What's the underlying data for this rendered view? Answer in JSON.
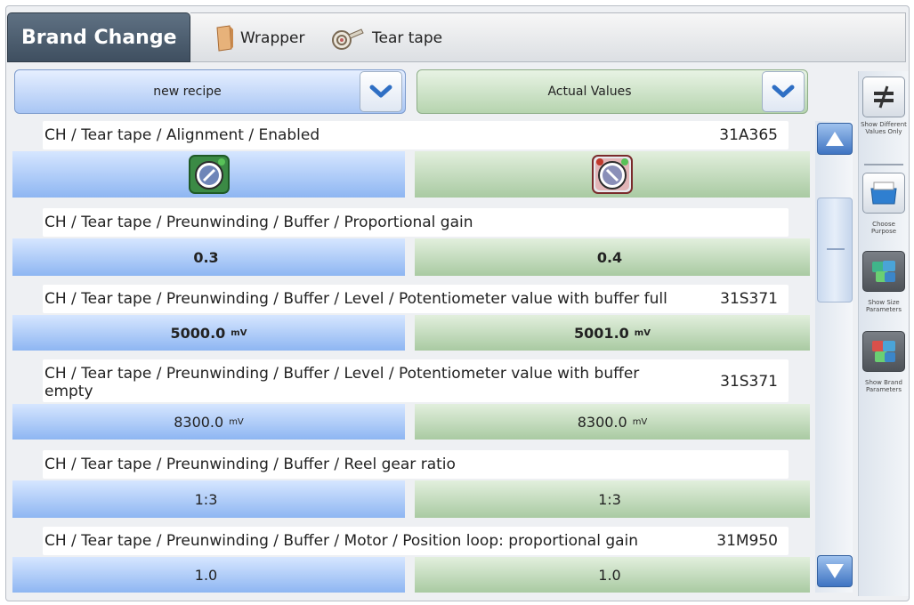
{
  "header": {
    "title": "Brand Change",
    "tabs": [
      {
        "label": "Wrapper",
        "icon": "wrapper-icon"
      },
      {
        "label": "Tear tape",
        "icon": "tear-tape-icon"
      }
    ]
  },
  "columns": {
    "left": {
      "label": "new recipe"
    },
    "right": {
      "label": "Actual Values"
    }
  },
  "rows": [
    {
      "title": "CH / Tear tape / Alignment / Enabled",
      "code": "31A365",
      "left": {
        "icon": "toggle-enabled-icon",
        "color": "#2f7d3a"
      },
      "right": {
        "icon": "toggle-disabled-icon",
        "color": "#c0392b"
      }
    },
    {
      "title": "CH / Tear tape / Preunwinding / Buffer / Proportional gain",
      "code": "",
      "left": {
        "value": "0.3",
        "unit": ""
      },
      "right": {
        "value": "0.4",
        "unit": ""
      }
    },
    {
      "title": "CH / Tear tape / Preunwinding / Buffer / Level / Potentiometer value with buffer full",
      "code": "31S371",
      "left": {
        "value": "5000.0",
        "unit": "mV"
      },
      "right": {
        "value": "5001.0",
        "unit": "mV"
      }
    },
    {
      "title": "CH / Tear tape / Preunwinding / Buffer / Level / Potentiometer value with buffer empty",
      "code": "31S371",
      "left": {
        "value": "8300.0",
        "unit": "mV"
      },
      "right": {
        "value": "8300.0",
        "unit": "mV"
      }
    },
    {
      "title": "CH / Tear tape / Preunwinding / Buffer / Reel gear ratio",
      "code": "",
      "left": {
        "value": "1:3",
        "unit": ""
      },
      "right": {
        "value": "1:3",
        "unit": ""
      }
    },
    {
      "title": "CH / Tear tape / Preunwinding / Buffer / Motor / Position loop: proportional gain",
      "code": "31M950",
      "left": {
        "value": "1.0",
        "unit": ""
      },
      "right": {
        "value": "1.0",
        "unit": ""
      }
    }
  ],
  "sidebar": {
    "buttons": [
      {
        "label": "Show Different Values Only",
        "icon": "not-equal-icon"
      },
      {
        "label": "Choose Purpose",
        "icon": "purpose-box-icon"
      },
      {
        "label": "Show Size Parameters",
        "icon": "size-parameters-icon"
      },
      {
        "label": "Show Brand Parameters",
        "icon": "brand-parameters-icon"
      }
    ]
  },
  "colors": {
    "left_column": "#a9c6f4",
    "right_column": "#b6d4af",
    "header_active": "#4a5a6b"
  }
}
